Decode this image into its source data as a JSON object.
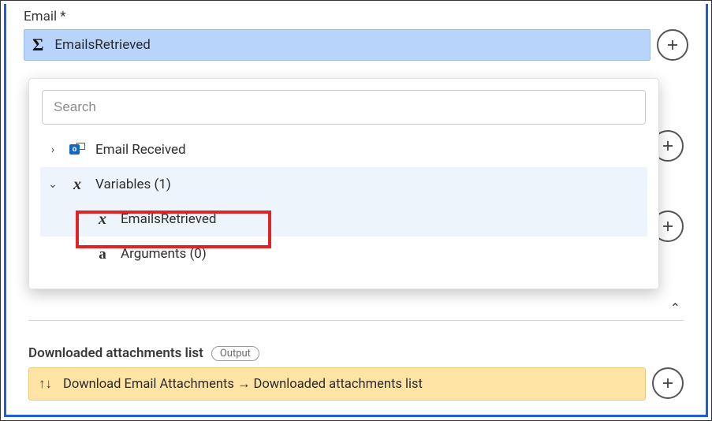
{
  "email_field": {
    "label": "Email *",
    "value": "EmailsRetrieved"
  },
  "dropdown": {
    "search_placeholder": "Search",
    "nodes": {
      "email_received": {
        "label": "Email Received"
      },
      "variables": {
        "label": "Variables (1)"
      },
      "emails_retrieved": {
        "label": "EmailsRetrieved"
      },
      "arguments": {
        "label": "Arguments (0)"
      }
    }
  },
  "attachments": {
    "label": "Downloaded attachments list",
    "badge": "Output",
    "value": "Download Email Attachments → Downloaded attachments list"
  }
}
